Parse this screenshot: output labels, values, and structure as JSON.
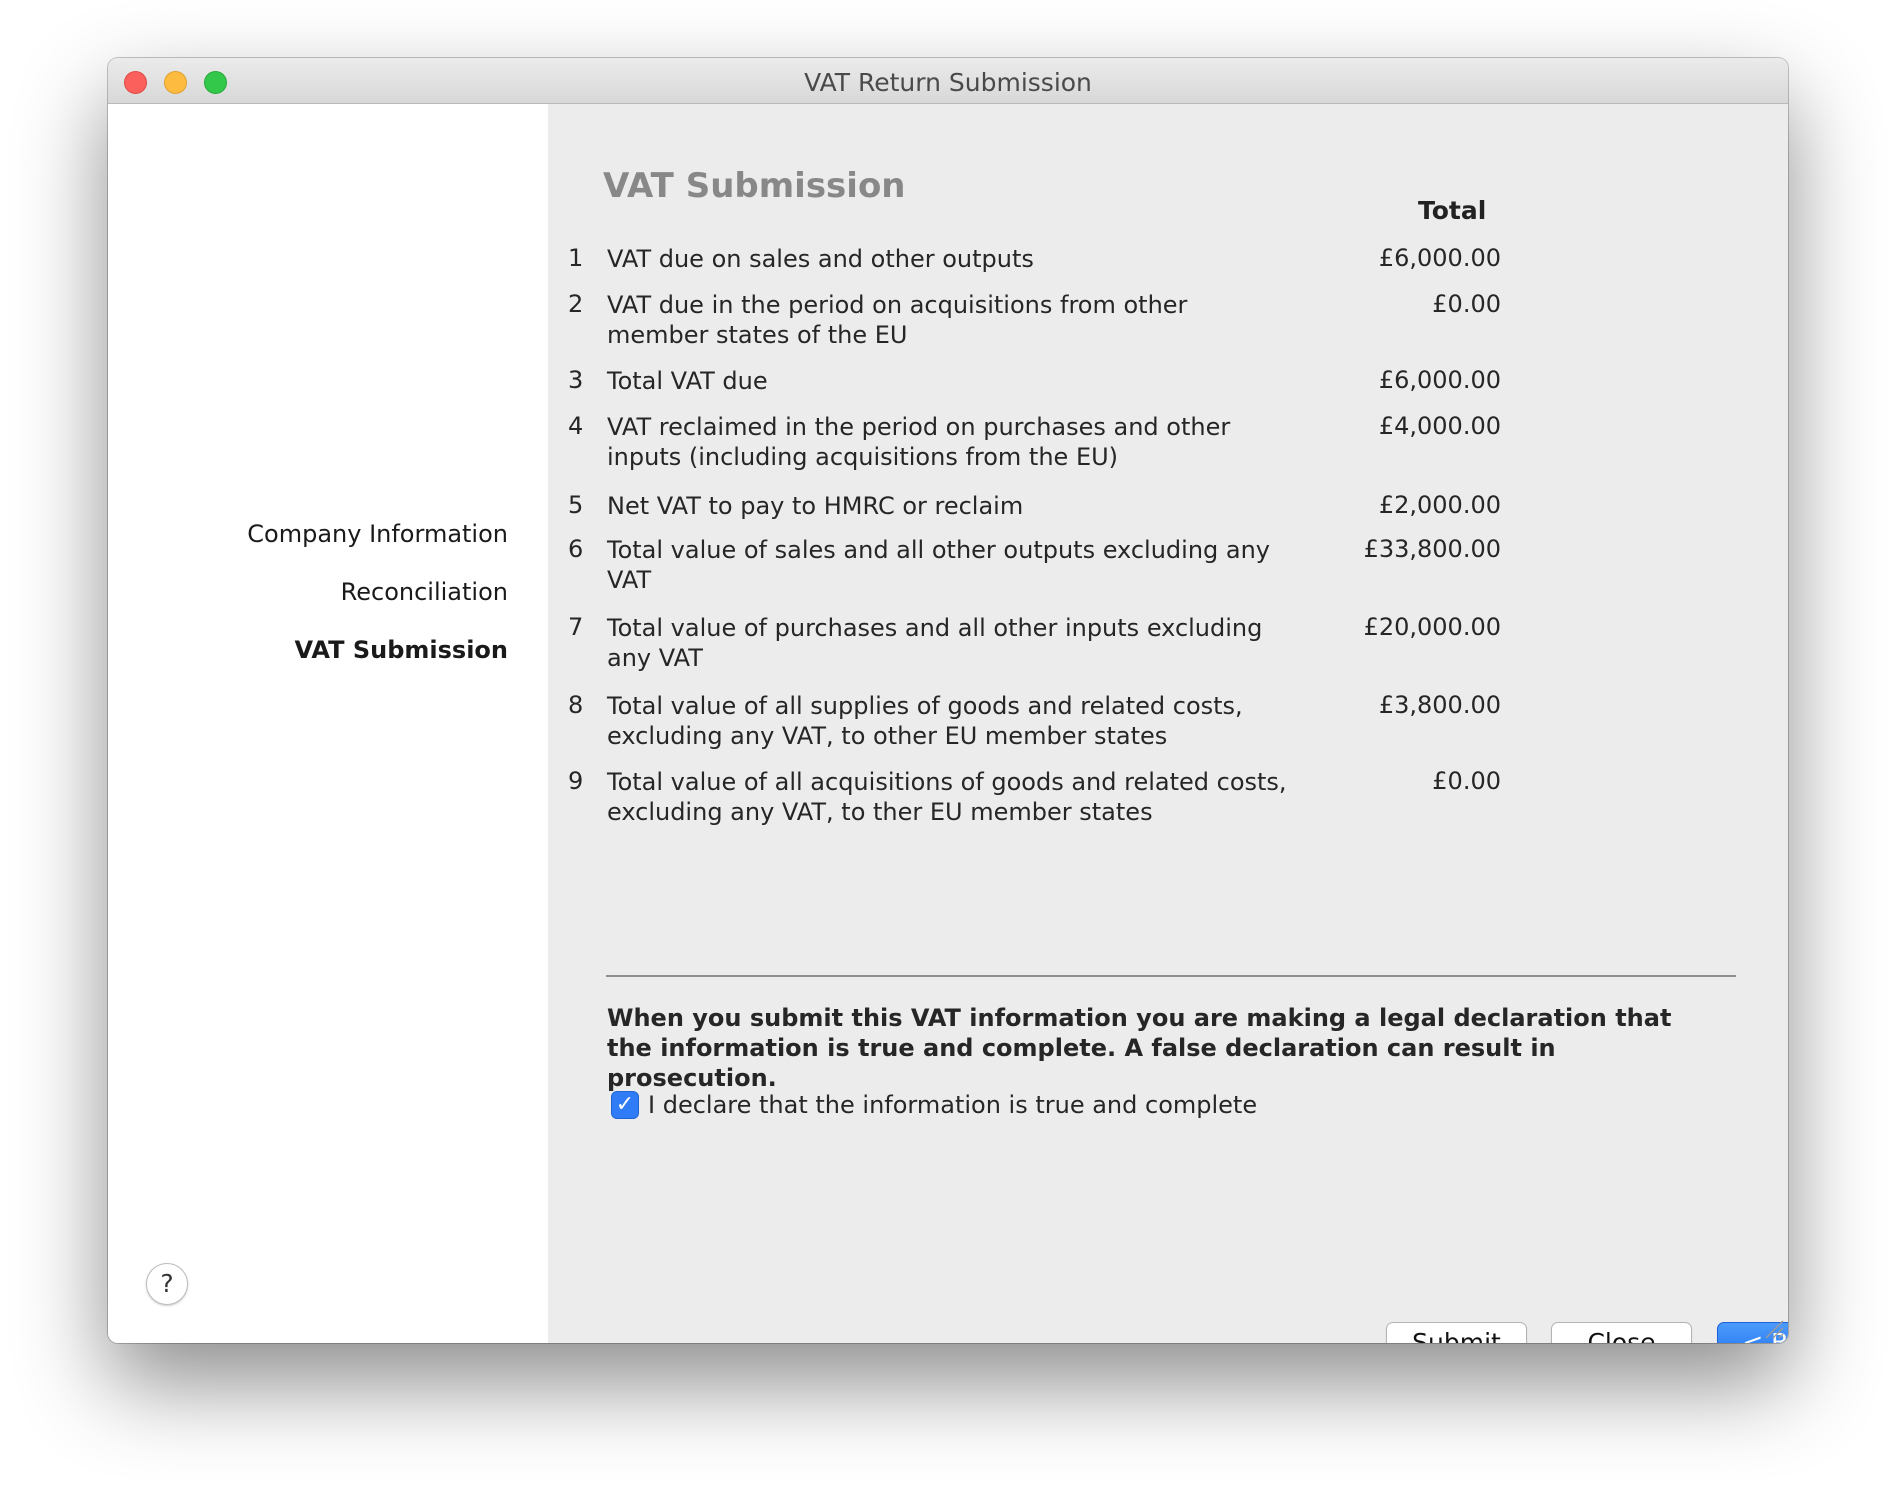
{
  "window": {
    "title": "VAT Return Submission"
  },
  "sidebar": {
    "steps": [
      {
        "label": "Company Information",
        "active": false
      },
      {
        "label": "Reconciliation",
        "active": false
      },
      {
        "label": "VAT Submission",
        "active": true
      }
    ],
    "help_label": "?"
  },
  "main": {
    "title": "VAT Submission",
    "column_header": "Total",
    "rows": [
      {
        "num": "1",
        "label": "VAT due on sales and other outputs",
        "value": "£6,000.00"
      },
      {
        "num": "2",
        "label": "VAT due in the period on acquisitions from other member states of the EU",
        "value": "£0.00"
      },
      {
        "num": "3",
        "label": "Total VAT due",
        "value": "£6,000.00"
      },
      {
        "num": "4",
        "label": "VAT reclaimed in the period on purchases and other inputs (including acquisitions from the EU)",
        "value": "£4,000.00"
      },
      {
        "num": "5",
        "label": "Net VAT to pay to HMRC or reclaim",
        "value": "£2,000.00"
      },
      {
        "num": "6",
        "label": "Total value of sales and all other outputs excluding any VAT",
        "value": "£33,800.00"
      },
      {
        "num": "7",
        "label": "Total value of purchases and all other inputs excluding any VAT",
        "value": "£20,000.00"
      },
      {
        "num": "8",
        "label": "Total value of all supplies of goods and related costs, excluding any VAT, to other EU member states",
        "value": "£3,800.00"
      },
      {
        "num": "9",
        "label": "Total value of all acquisitions of goods and related costs, excluding any VAT, to ther EU member states",
        "value": "£0.00"
      }
    ],
    "declaration": "When you submit this VAT information you are making a legal declaration that the information is true and complete. A false declaration can result in prosecution.",
    "checkbox": {
      "label": "I declare that the information is true and complete",
      "checked": true,
      "mark": "✓"
    }
  },
  "buttons": {
    "submit": "Submit",
    "close": "Close",
    "back": "< Back"
  },
  "colors": {
    "accent": "#2f7cf6",
    "close_light": "#fc605c",
    "minimize_light": "#fdbc40",
    "zoom_light": "#34c84a"
  }
}
